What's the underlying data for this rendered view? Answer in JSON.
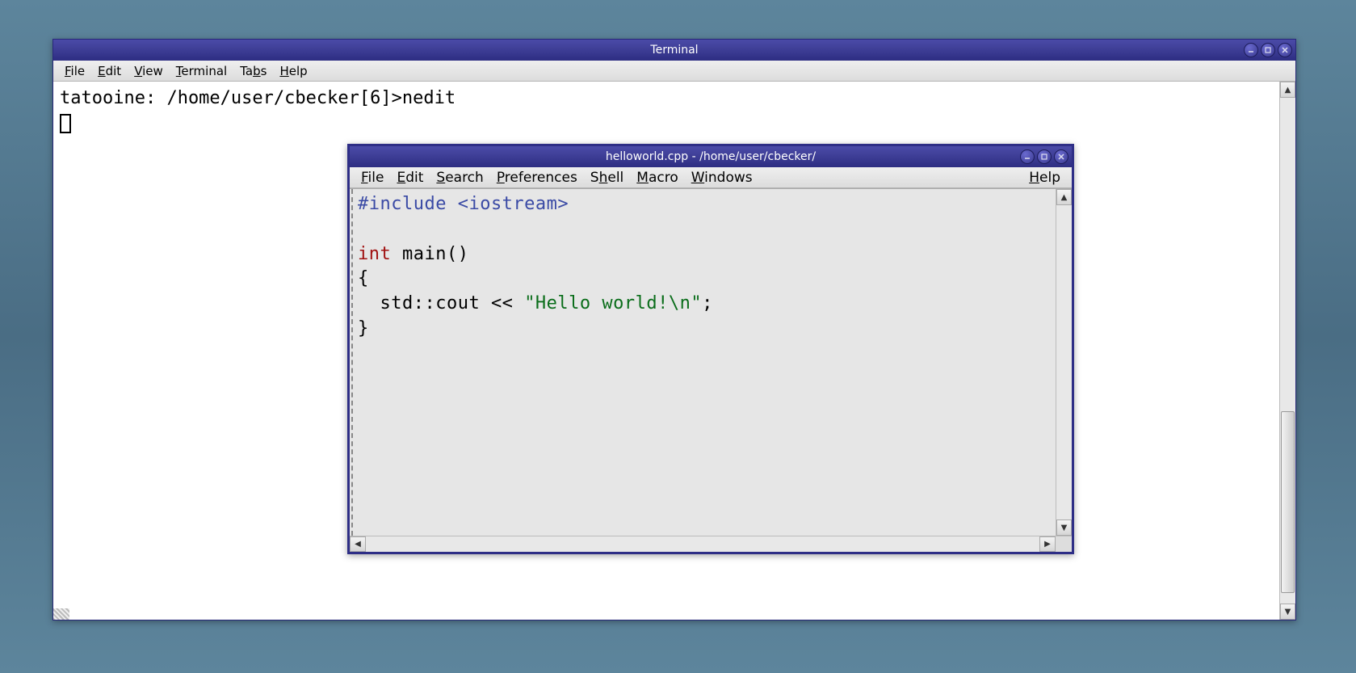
{
  "terminal": {
    "title": "Terminal",
    "menu": {
      "file": "File",
      "edit": "Edit",
      "view": "View",
      "terminal": "Terminal",
      "tabs": "Tabs",
      "help": "Help"
    },
    "prompt_line": "tatooine: /home/user/cbecker[6]>nedit"
  },
  "nedit": {
    "title": "helloworld.cpp - /home/user/cbecker/",
    "menu": {
      "file": "File",
      "edit": "Edit",
      "search": "Search",
      "preferences": "Preferences",
      "shell": "Shell",
      "macro": "Macro",
      "windows": "Windows",
      "help": "Help"
    },
    "code": {
      "include": "#include <iostream>",
      "blank1": "",
      "int_kw": "int",
      "main_rest": " main()",
      "open_brace": "{",
      "cout_indent": "  std::cout << ",
      "string_lit": "\"Hello world!\\n\"",
      "cout_end": ";",
      "close_brace": "}"
    }
  }
}
